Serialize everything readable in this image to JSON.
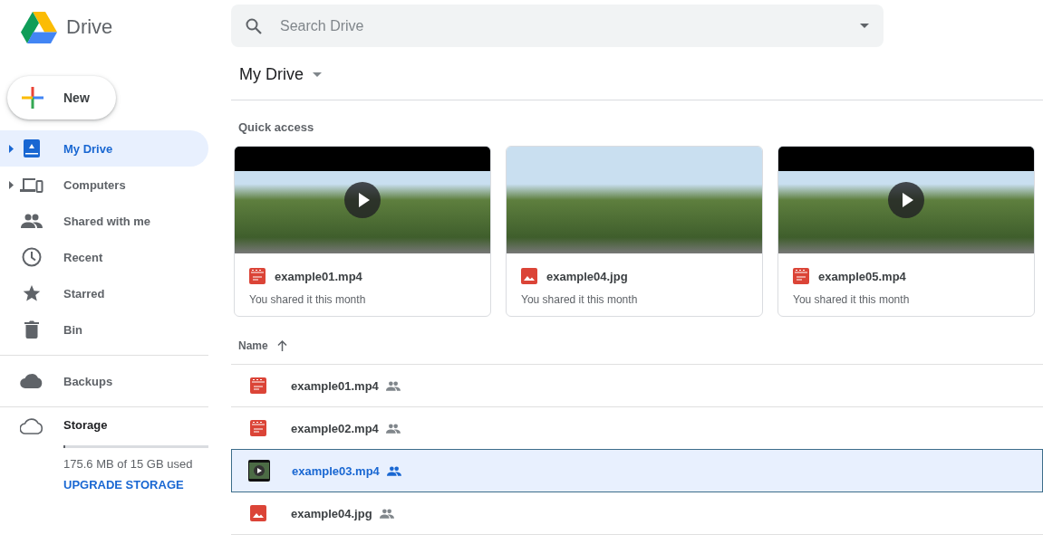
{
  "app": {
    "name": "Drive"
  },
  "search": {
    "placeholder": "Search Drive"
  },
  "new_button": {
    "label": "New"
  },
  "sidebar": {
    "items": [
      {
        "kind": "drive",
        "label": "My Drive",
        "selected": true,
        "expandable": true
      },
      {
        "kind": "computers",
        "label": "Computers",
        "selected": false,
        "expandable": true
      },
      {
        "kind": "shared",
        "label": "Shared with me",
        "selected": false,
        "expandable": false
      },
      {
        "kind": "recent",
        "label": "Recent",
        "selected": false,
        "expandable": false
      },
      {
        "kind": "starred",
        "label": "Starred",
        "selected": false,
        "expandable": false
      },
      {
        "kind": "bin",
        "label": "Bin",
        "selected": false,
        "expandable": false
      }
    ],
    "backups": {
      "label": "Backups"
    },
    "storage": {
      "label": "Storage",
      "level": 0.012,
      "usage": "175.6 MB of 15 GB used",
      "upgrade": "UPGRADE STORAGE"
    }
  },
  "breadcrumb": {
    "label": "My Drive"
  },
  "quick_access": {
    "title": "Quick access",
    "cards": [
      {
        "kind": "video",
        "name": "example01.mp4",
        "detail": "You shared it this month"
      },
      {
        "kind": "image",
        "name": "example04.jpg",
        "detail": "You shared it this month"
      },
      {
        "kind": "video",
        "name": "example05.mp4",
        "detail": "You shared it this month"
      }
    ]
  },
  "file_list": {
    "columns": [
      {
        "label": "Name"
      }
    ],
    "rows": [
      {
        "kind": "video",
        "name": "example01.mp4",
        "shared": true,
        "selected": false
      },
      {
        "kind": "video",
        "name": "example02.mp4",
        "shared": true,
        "selected": false
      },
      {
        "kind": "thumbnail",
        "name": "example03.mp4",
        "shared": true,
        "selected": true
      },
      {
        "kind": "image",
        "name": "example04.jpg",
        "shared": true,
        "selected": false
      }
    ]
  }
}
